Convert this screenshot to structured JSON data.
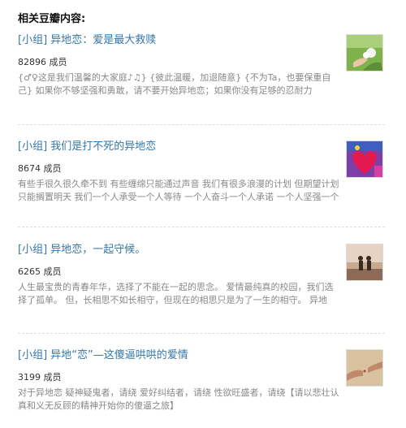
{
  "heading": "相关豆瓣内容:",
  "items": [
    {
      "tag": "[小组]",
      "name": "异地恋：爱是最大救赎",
      "members": "82896 成员",
      "desc": "{♂♀这是我们温馨的大家庭♪♫} {彼此温暖，加退随意} {不为Ta，也要保重自己} 如果你不够坚强和勇敢，请不要开始异地恋；如果你没有足够的忍耐力"
    },
    {
      "tag": "[小组]",
      "name": "我们是打不死的异地恋",
      "members": "8674 成员",
      "desc": "有些手很久很久牵不到 有些缠绵只能通过声音 我们有很多浪漫的计划 但期望计划只能搁置明天 我们一个人承受一个人等待 一个人奋斗一个人承诺 一个人坚强一个人..."
    },
    {
      "tag": "[小组]",
      "name": "异地恋，一起守候。",
      "members": "6265 成员",
      "desc": "人生最宝贵的青春年华，选择了不能在一起的思念。 爱情最纯真的校园，我们选择了孤单。 但，长相思不如长相守，但现在的相思只是为了一生的相守。 异地恋，一种挑..."
    },
    {
      "tag": "[小组]",
      "name": "异地“恋”—这傻逼哄哄的爱情",
      "members": "3199 成员",
      "desc": "对于异地恋 疑神疑鬼者，请绕 爱好纠结者，请绕 性欲旺盛者，请绕【请以悲壮认真和义无反顾的精神开始你的傻逼之旅】"
    }
  ]
}
